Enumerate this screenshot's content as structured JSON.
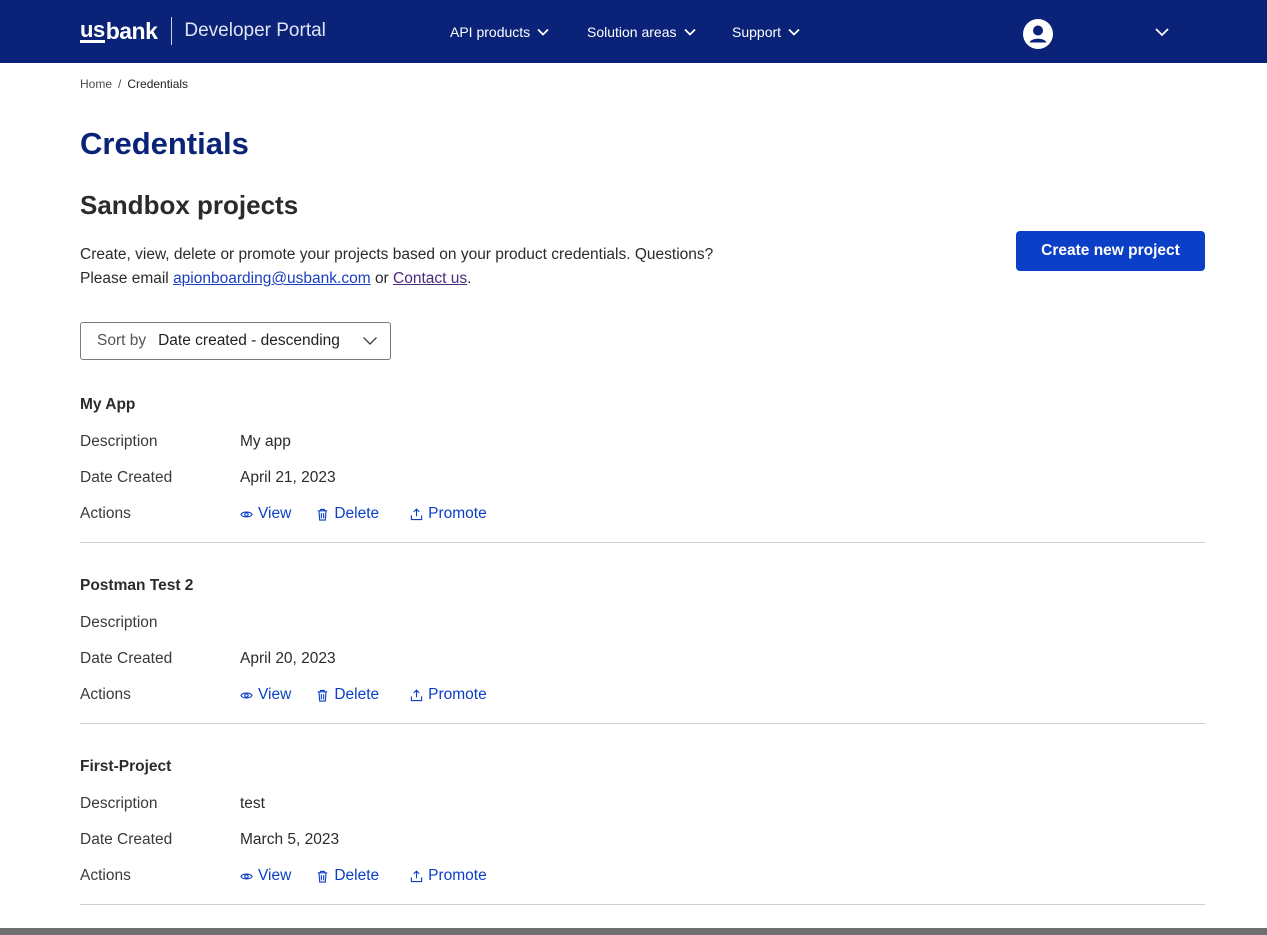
{
  "header": {
    "logo_us": "us",
    "logo_bank": "bank",
    "portal_name": "Developer Portal",
    "nav": [
      {
        "label": "API products"
      },
      {
        "label": "Solution areas"
      },
      {
        "label": "Support"
      }
    ],
    "bg_color": "#0a2378"
  },
  "breadcrumb": {
    "home": "Home",
    "separator": "/",
    "current": "Credentials"
  },
  "page_title": "Credentials",
  "section_title": "Sandbox projects",
  "intro": {
    "line1": "Create, view, delete or promote your projects based on your product credentials. Questions?",
    "line2_prefix": "Please email",
    "email": "apionboarding@usbank.com",
    "or": "or",
    "contact": "Contact us",
    "end": "."
  },
  "create_button": "Create new project",
  "sort": {
    "label": "Sort by",
    "value": "Date created - descending"
  },
  "labels": {
    "description": "Description",
    "date_created": "Date Created",
    "actions": "Actions",
    "view": "View",
    "delete": "Delete",
    "promote": "Promote"
  },
  "projects": [
    {
      "name": "My App",
      "description": "My app",
      "date_created": "April 21, 2023"
    },
    {
      "name": "Postman Test 2",
      "description": "",
      "date_created": "April 20, 2023"
    },
    {
      "name": "First-Project",
      "description": "test",
      "date_created": "March 5, 2023"
    }
  ],
  "colors": {
    "brand_navy": "#0a2378",
    "primary_blue": "#0c3fc7"
  }
}
